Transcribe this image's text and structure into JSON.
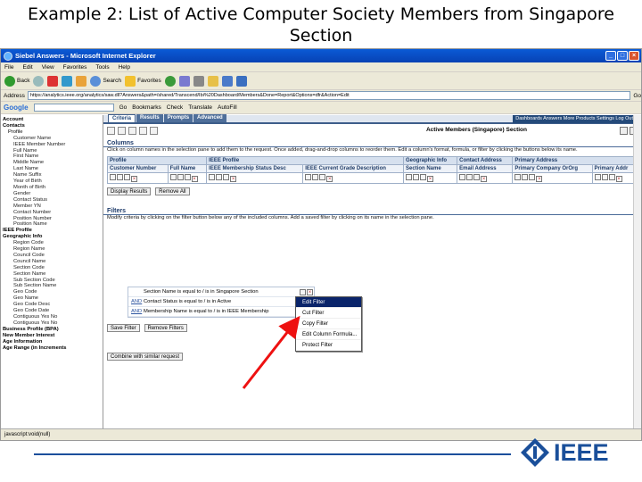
{
  "slide": {
    "title": "Example 2: List of Active Computer Society Members from Singapore Section",
    "logo_text": "IEEE"
  },
  "browser": {
    "window_title": "Siebel Answers - Microsoft Internet Explorer",
    "menu": [
      "File",
      "Edit",
      "View",
      "Favorites",
      "Tools",
      "Help"
    ],
    "toolbar": {
      "back": "Back",
      "search": "Search",
      "favorites": "Favorites"
    },
    "address_label": "Address",
    "address": "https://analytics.ieee.org/analytics/saw.dll?Answers&path=/shared/Transcend/Ibi%20Dashboard/Members&Done=Report&Options=dfr&Action=Edit",
    "go_label": "Go",
    "google_toolbar": {
      "logo": "Google",
      "go": "Go",
      "bookmarks": "Bookmarks",
      "check": "Check",
      "translate": "Translate",
      "autofill": "AutoFill"
    },
    "status_text": "javascript:void(null)"
  },
  "sidebar": {
    "items": [
      {
        "label": "Account",
        "level": 0
      },
      {
        "label": "Contacts",
        "level": 0
      },
      {
        "label": "Profile",
        "level": 1
      },
      {
        "label": "Customer Name",
        "level": 2
      },
      {
        "label": "IEEE Member Number",
        "level": 2
      },
      {
        "label": "Full Name",
        "level": 2
      },
      {
        "label": "First Name",
        "level": 2
      },
      {
        "label": "Middle Name",
        "level": 2
      },
      {
        "label": "Last Name",
        "level": 2
      },
      {
        "label": "Name Suffix",
        "level": 2
      },
      {
        "label": "Year of Birth",
        "level": 2
      },
      {
        "label": "Month of Birth",
        "level": 2
      },
      {
        "label": "Gender",
        "level": 2
      },
      {
        "label": "Contact Status",
        "level": 2
      },
      {
        "label": "Member YN",
        "level": 2
      },
      {
        "label": "Contact Number",
        "level": 2
      },
      {
        "label": "Position Number",
        "level": 2
      },
      {
        "label": "Position Name",
        "level": 2
      },
      {
        "label": "IEEE Profile",
        "level": 0
      },
      {
        "label": "Geographic Info",
        "level": 0
      },
      {
        "label": "Region Code",
        "level": 2
      },
      {
        "label": "Region Name",
        "level": 2
      },
      {
        "label": "Council Code",
        "level": 2
      },
      {
        "label": "Council Name",
        "level": 2
      },
      {
        "label": "Section Code",
        "level": 2
      },
      {
        "label": "Section Name",
        "level": 2
      },
      {
        "label": "Sub Section Code",
        "level": 2
      },
      {
        "label": "Sub Section Name",
        "level": 2
      },
      {
        "label": "Geo Code",
        "level": 2
      },
      {
        "label": "Geo Name",
        "level": 2
      },
      {
        "label": "Geo Code Desc",
        "level": 2
      },
      {
        "label": "Geo Code Date",
        "level": 2
      },
      {
        "label": "Contiguous Yes No",
        "level": 2
      },
      {
        "label": "Contiguous Yes No",
        "level": 2
      },
      {
        "label": "Business Profile (BPA)",
        "level": 0
      },
      {
        "label": "New Member Interest",
        "level": 0
      },
      {
        "label": "Age Information",
        "level": 0
      },
      {
        "label": "Age Range (in Increments",
        "level": 0
      }
    ]
  },
  "tabs": [
    "Criteria",
    "Results",
    "Prompts",
    "Advanced"
  ],
  "header_links": "Dashboards Answers More Products Settings Log Out",
  "report_title": "Active Members (Singapore) Section",
  "columns_section": {
    "heading": "Columns",
    "description": "Click on column names in the selection pane to add them to the request. Once added, drag-and-drop columns to reorder them. Edit a column's format, formula, or filter by clicking the buttons below its name.",
    "group_headers": [
      "Profile",
      "IEEE Profile",
      "Geographic Info",
      "Contact Address",
      "Primary Address"
    ],
    "columns": [
      "Customer Number",
      "Full Name",
      "IEEE Membership Status Desc",
      "IEEE Current Grade Description",
      "Section Name",
      "Email Address",
      "Primary Company OrOrg",
      "Primary Addr"
    ],
    "buttons": {
      "display_results": "Display Results",
      "remove_all": "Remove All"
    }
  },
  "filters_section": {
    "heading": "Filters",
    "description": "Modify criteria by clicking on the filter button below any of the included columns. Add a saved filter by clicking on its name in the selection pane.",
    "rows": [
      {
        "conj": "",
        "text": "Section Name is equal to / is in Singapore Section"
      },
      {
        "conj": "AND",
        "text": "Contact Status is equal to / is in Active"
      },
      {
        "conj": "AND",
        "text": "Membership Name is equal to / is in IEEE Membership"
      }
    ],
    "buttons": {
      "save_filter": "Save Filter",
      "remove_filters": "Remove Filters",
      "combine": "Combine with similar request"
    }
  },
  "context_menu": [
    "Edit Filter",
    "Cut Filter",
    "Copy Filter",
    "Edit Column Formula...",
    "Protect Filter"
  ]
}
